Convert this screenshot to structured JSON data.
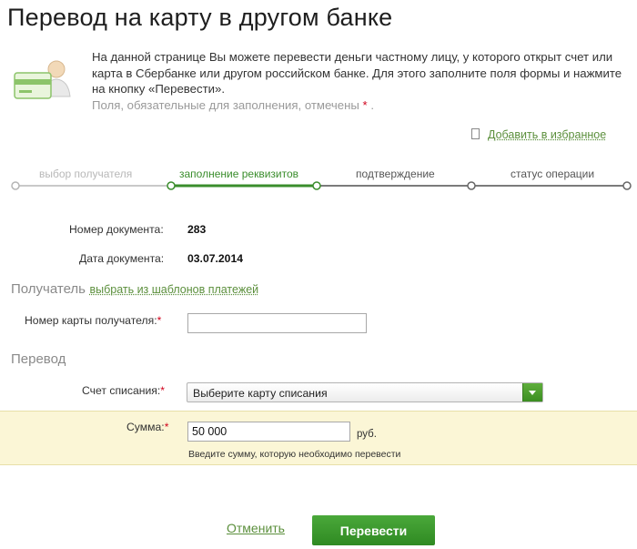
{
  "page": {
    "title": "Перевод на карту в другом банке",
    "intro_text": "На данной странице Вы можете перевести деньги частному лицу, у которого открыт счет или карта в Сбербанке или другом российском банке. Для этого заполните поля формы и нажмите на кнопку «Перевести».",
    "required_note": "Поля, обязательные для заполнения, отмечены",
    "required_mark": "*",
    "required_note_end": "."
  },
  "favorites": {
    "label": "Добавить в избранное"
  },
  "steps": [
    {
      "label": "выбор получателя",
      "state": "done"
    },
    {
      "label": "заполнение реквизитов",
      "state": "current"
    },
    {
      "label": "подтверждение",
      "state": "next"
    },
    {
      "label": "статус операции",
      "state": "next"
    }
  ],
  "document": {
    "number_label": "Номер документа:",
    "number_value": "283",
    "date_label": "Дата документа:",
    "date_value": "03.07.2014"
  },
  "recipient": {
    "section_title": "Получатель",
    "templates_link": "выбрать из шаблонов платежей",
    "card_label": "Номер карты получателя:",
    "card_value": ""
  },
  "transfer": {
    "section_title": "Перевод",
    "account_label": "Счет списания:",
    "account_selected": "Выберите карту списания",
    "amount_label": "Сумма:",
    "amount_value": "50 000",
    "currency": "руб.",
    "amount_hint": "Введите сумму, которую необходимо перевести"
  },
  "actions": {
    "cancel_label": "Отменить",
    "submit_label": "Перевести"
  },
  "colors": {
    "accent_green": "#3a8d2c",
    "link_green": "#5b8f3c",
    "required_red": "#d0021b",
    "highlight_band": "#fbf6d6"
  }
}
